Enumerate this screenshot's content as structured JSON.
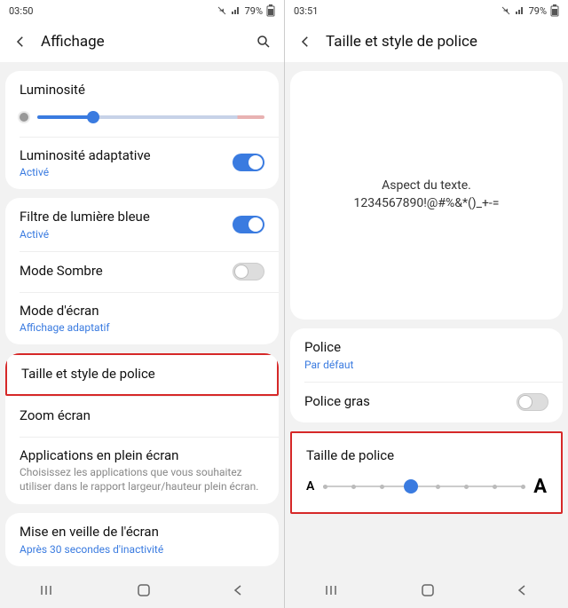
{
  "left": {
    "status": {
      "time": "03:50",
      "battery": "79%"
    },
    "header": {
      "title": "Affichage"
    },
    "brightness": {
      "title": "Luminosité",
      "thumb_pct": 22
    },
    "adaptive": {
      "title": "Luminosité adaptative",
      "sub": "Activé",
      "on": true
    },
    "bluelight": {
      "title": "Filtre de lumière bleue",
      "sub": "Activé",
      "on": true
    },
    "dark": {
      "title": "Mode Sombre",
      "on": false
    },
    "screenmode": {
      "title": "Mode d'écran",
      "sub": "Affichage adaptatif"
    },
    "fontstyle": {
      "title": "Taille et style de police"
    },
    "zoom": {
      "title": "Zoom écran"
    },
    "fullscreen": {
      "title": "Applications en plein écran",
      "desc": "Choisissez les applications que vous souhaitez utiliser dans le rapport largeur/hauteur plein écran."
    },
    "sleep": {
      "title": "Mise en veille de l'écran",
      "sub": "Après 30 secondes d'inactivité"
    }
  },
  "right": {
    "status": {
      "time": "03:51",
      "battery": "79%"
    },
    "header": {
      "title": "Taille et style de police"
    },
    "preview": {
      "line1": "Aspect du texte.",
      "line2": "1234567890!@#%&*()_+-="
    },
    "font": {
      "title": "Police",
      "sub": "Par défaut"
    },
    "bold": {
      "title": "Police gras",
      "on": false
    },
    "size": {
      "title": "Taille de police",
      "value_index": 3,
      "steps": 8
    }
  }
}
